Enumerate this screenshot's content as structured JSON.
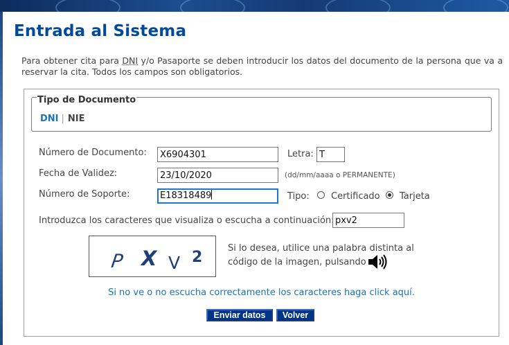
{
  "page": {
    "title": "Entrada al Sistema",
    "intro_prefix": "Para obtener cita para ",
    "intro_abbr": "DNI",
    "intro_suffix": " y/o Pasaporte se deben introducir los datos del documento de la persona que va a reservar la cita. Todos los campos son obligatorios."
  },
  "doc_type": {
    "legend": "Tipo de Documento",
    "tabs": [
      {
        "label": "DNI",
        "active": true
      },
      {
        "label": "NIE",
        "active": false
      }
    ],
    "separator": "|"
  },
  "form": {
    "doc_number_label": "Número de Documento:",
    "doc_number_value": "X6904301",
    "letter_label": "Letra:",
    "letter_value": "T",
    "validity_label": "Fecha de Validez:",
    "validity_value": "23/10/2020",
    "validity_hint": "(dd/mm/aaaa o PERMANENTE)",
    "support_label": "Número de Soporte:",
    "support_value": "E18318489",
    "type_label": "Tipo:",
    "type_options": [
      {
        "label": "Certificado",
        "checked": false
      },
      {
        "label": "Tarjeta",
        "checked": true
      }
    ],
    "captcha_label": "Introduzca los caracteres que visualiza o escucha a continuación:",
    "captcha_value": "pxv2"
  },
  "captcha": {
    "chars": [
      "P",
      "X",
      "V",
      "2"
    ],
    "note_line1": "Si lo desea, utilice una palabra distinta al",
    "note_line2": "código de la imagen, pulsando",
    "audio_icon": "speaker-icon"
  },
  "help_link": "Si no ve o no escucha correctamente los caracteres haga click aquí.",
  "buttons": {
    "submit": "Enviar datos",
    "back": "Volver"
  },
  "colors": {
    "title": "#004a99",
    "link": "#1a73b8",
    "button_bg": "#00338a",
    "focus": "#1b78d0"
  }
}
